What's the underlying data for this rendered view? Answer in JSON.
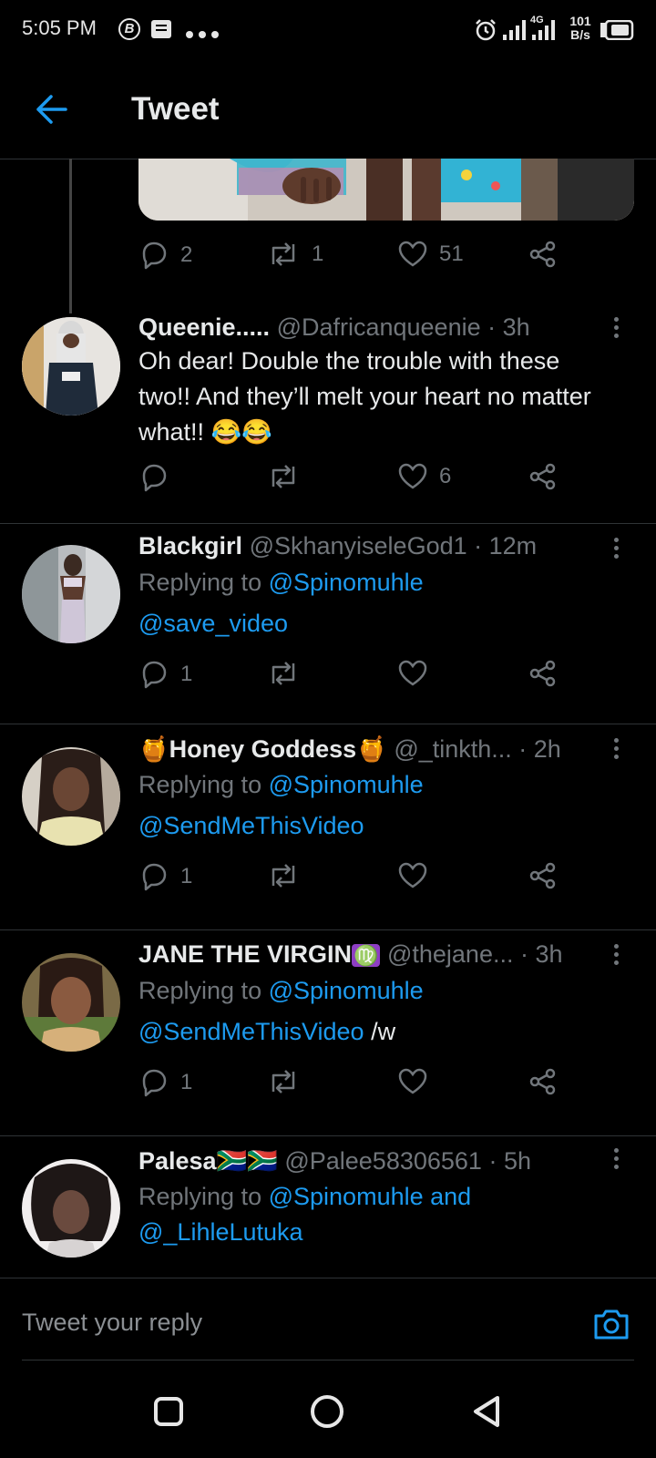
{
  "status_bar": {
    "time": "5:05 PM",
    "network": "4G",
    "speed_value": "101",
    "speed_unit": "B/s",
    "icons": [
      "b-badge-icon",
      "message-icon",
      "more-dots-icon",
      "alarm-icon",
      "signal-icon",
      "signal-4g-icon",
      "battery-icon"
    ]
  },
  "header": {
    "title": "Tweet",
    "back_icon": "back-arrow-icon"
  },
  "parent_tweet": {
    "reply_count": "2",
    "retweet_count": "1",
    "like_count": "51"
  },
  "replies": [
    {
      "name": "Queenie.....",
      "handle": "@Dafricanqueenie",
      "time": "· 3h",
      "text": "Oh dear! Double the trouble with these two!! And they’ll melt your heart no matter what!! 😂😂",
      "reply_count": "",
      "retweet_count": "",
      "like_count": "6"
    },
    {
      "name": "Blackgirl",
      "handle": "@SkhanyiseleGod1",
      "time": "· 12m",
      "replying_prefix": "Replying to",
      "replying_to": "@Spinomuhle",
      "mention": "@save_video",
      "reply_count": "1",
      "retweet_count": "",
      "like_count": ""
    },
    {
      "name_emoji_left": "🍯",
      "name": "Honey Goddess",
      "name_emoji_right": "🍯",
      "handle": "@_tinkth...",
      "time": "· 2h",
      "replying_prefix": "Replying to",
      "replying_to": "@Spinomuhle",
      "mention": "@SendMeThisVideo",
      "reply_count": "1",
      "retweet_count": "",
      "like_count": ""
    },
    {
      "name": "JANE THE VIRGIN",
      "name_emoji_right": "♍",
      "handle": "@thejane...",
      "time": "· 3h",
      "replying_prefix": "Replying to",
      "replying_to": "@Spinomuhle",
      "mention": "@SendMeThisVideo",
      "suffix": "/w",
      "reply_count": "1",
      "retweet_count": "",
      "like_count": ""
    },
    {
      "name": "Palesa",
      "name_emoji_right": "🇿🇦🇿🇦",
      "handle": "@Palee58306561",
      "time": "· 5h",
      "replying_prefix": "Replying to",
      "replying_to": "@Spinomuhle and",
      "replying_to_2": "@_LihleLutuka"
    }
  ],
  "reply_bar": {
    "placeholder": "Tweet your reply",
    "camera_icon": "camera-icon"
  },
  "nav_bar": {
    "icons": [
      "recent-apps-icon",
      "home-icon",
      "back-icon"
    ]
  },
  "colors": {
    "accent": "#1d9bf0",
    "muted": "#71767b",
    "text": "#e7e9ea",
    "background": "#000000"
  }
}
